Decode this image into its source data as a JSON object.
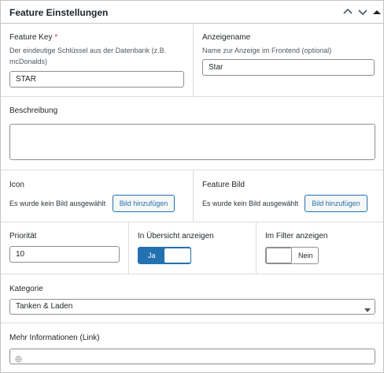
{
  "header": {
    "title": "Feature Einstellungen",
    "buttons": [
      "chevron-up-icon",
      "chevron-down-icon",
      "collapse-icon"
    ]
  },
  "feature_key": {
    "label": "Feature Key",
    "required_mark": "*",
    "description": "Der eindeutige Schlüssel aus der Datenbank (z.B. mcDonalds)",
    "value": "STAR"
  },
  "anzeigename": {
    "label": "Anzeigename",
    "description": "Name zur Anzeige im Frontend (optional)",
    "value": "Star"
  },
  "beschreibung": {
    "label": "Beschreibung",
    "value": ""
  },
  "icon": {
    "label": "Icon",
    "status": "Es wurde kein Bild ausgewählt",
    "button": "Bild hinzufügen"
  },
  "feature_bild": {
    "label": "Feature Bild",
    "status": "Es wurde kein Bild ausgewählt",
    "button": "Bild hinzufügen"
  },
  "prioritaet": {
    "label": "Priorität",
    "value": "10"
  },
  "uebersicht": {
    "label": "In Übersicht anzeigen",
    "state": "Ja",
    "on": true
  },
  "filter": {
    "label": "Im Filter anzeigen",
    "state": "Nein",
    "on": false
  },
  "kategorie": {
    "label": "Kategorie",
    "selected": "Tanken & Laden"
  },
  "mehr_info": {
    "label": "Mehr Informationen (Link)",
    "value": "",
    "icon": "globe-icon"
  },
  "colors": {
    "accent": "#2271b1",
    "border": "#c3c4c7",
    "required": "#d63638"
  }
}
